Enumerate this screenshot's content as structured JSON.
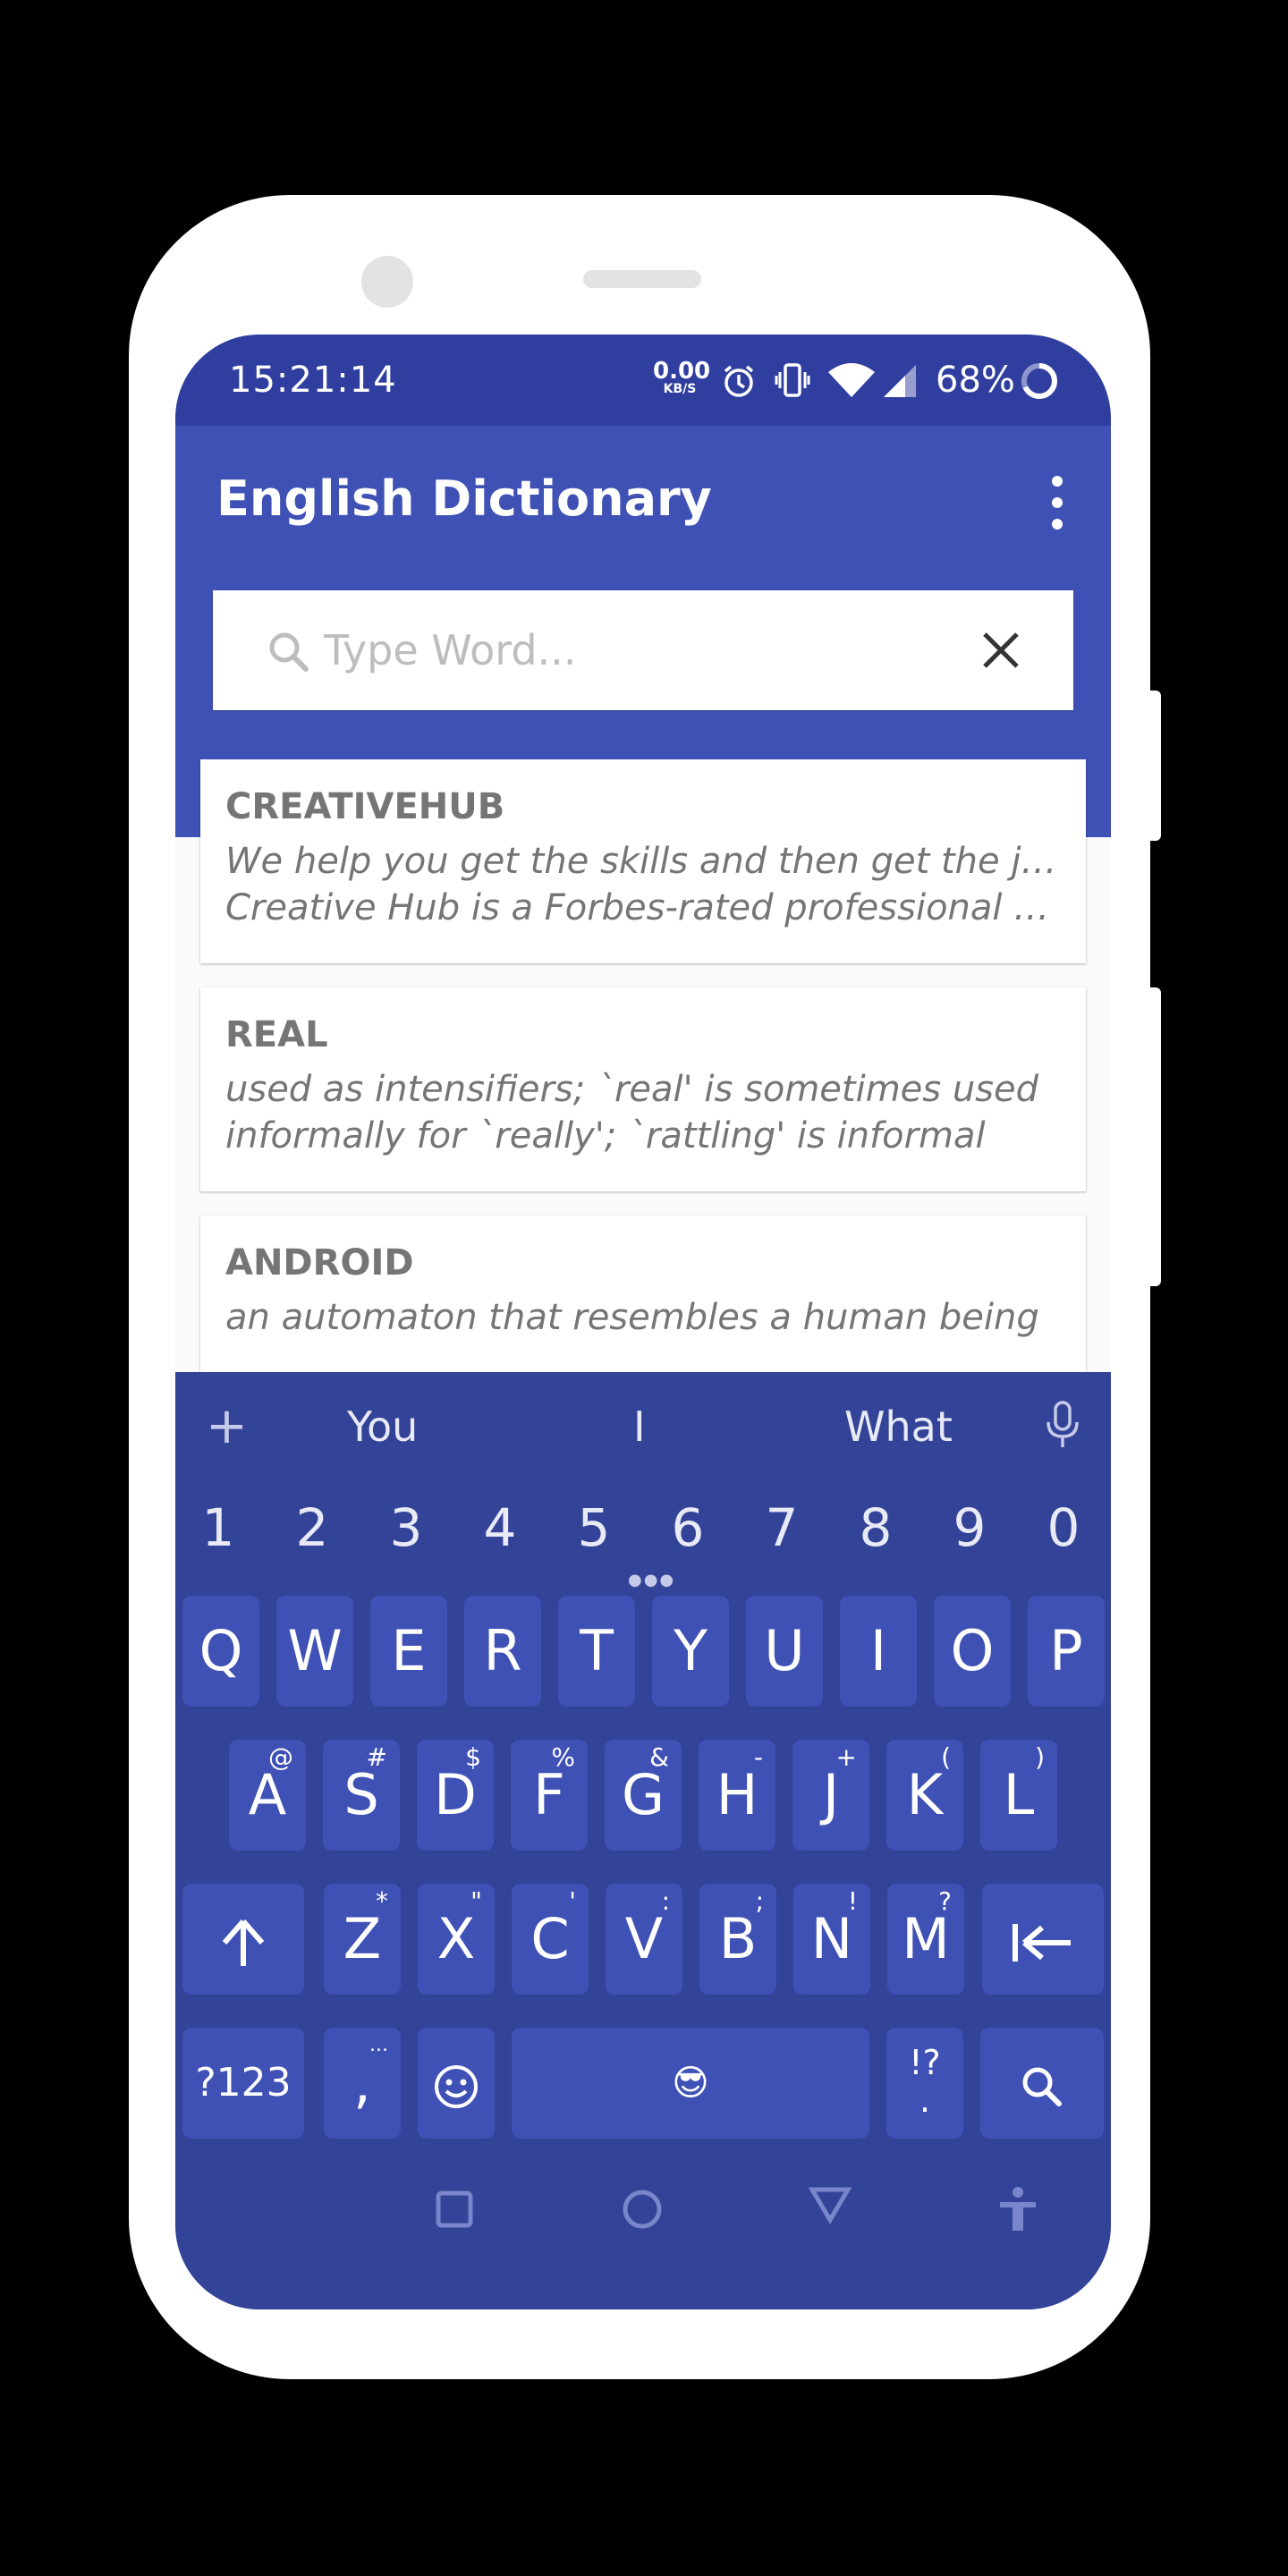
{
  "status": {
    "time": "15:21:14",
    "net_speed": "0.00",
    "net_unit": "KB/S",
    "battery": "68%"
  },
  "app": {
    "title": "English Dictionary"
  },
  "search": {
    "placeholder": "Type Word...",
    "value": ""
  },
  "results": [
    {
      "word": "CREATIVEHUB",
      "line1": "We help you get the skills and then get the job",
      "line2": "Creative Hub is a Forbes-rated professional tr..."
    },
    {
      "word": "REAL",
      "line1": "used as intensifiers; `real' is sometimes used",
      "line2": "informally for `really'; `rattling' is informal"
    },
    {
      "word": "ANDROID",
      "line1": "an automaton that resembles a human being",
      "line2": ""
    }
  ],
  "keyboard": {
    "suggestions": [
      "You",
      "I",
      "What"
    ],
    "numbers": [
      "1",
      "2",
      "3",
      "4",
      "5",
      "6",
      "7",
      "8",
      "9",
      "0"
    ],
    "row1": [
      "Q",
      "W",
      "E",
      "R",
      "T",
      "Y",
      "U",
      "I",
      "O",
      "P"
    ],
    "row2": [
      {
        "key": "A",
        "alt": "@"
      },
      {
        "key": "S",
        "alt": "#"
      },
      {
        "key": "D",
        "alt": "$"
      },
      {
        "key": "F",
        "alt": "%"
      },
      {
        "key": "G",
        "alt": "&"
      },
      {
        "key": "H",
        "alt": "-"
      },
      {
        "key": "J",
        "alt": "+"
      },
      {
        "key": "K",
        "alt": "("
      },
      {
        "key": "L",
        "alt": ")"
      }
    ],
    "row3": [
      {
        "key": "Z",
        "alt": "*"
      },
      {
        "key": "X",
        "alt": "\""
      },
      {
        "key": "C",
        "alt": "'"
      },
      {
        "key": "V",
        "alt": ":"
      },
      {
        "key": "B",
        "alt": ";"
      },
      {
        "key": "N",
        "alt": "!"
      },
      {
        "key": "M",
        "alt": "?"
      }
    ],
    "symbols_label": "?123",
    "comma": ",",
    "comma_alt": "...",
    "period_label": "!?",
    "period_sub": ".",
    "space_emoji": "😎"
  },
  "icons": {
    "menu": "more-vert-icon",
    "search": "search-icon",
    "clear": "close-icon",
    "mic": "mic-icon",
    "shift": "shift-arrow-icon",
    "backspace": "backspace-icon",
    "emoji": "smiley-icon",
    "keyboard_search": "search-icon",
    "nav_recents": "square-icon",
    "nav_home": "circle-icon",
    "nav_back": "triangle-icon",
    "nav_accessibility": "accessibility-icon"
  },
  "colors": {
    "status_bar": "#303f9f",
    "app_bar": "#3f51b5",
    "keyboard_bg": "#334397",
    "key_bg": "#3f51b5"
  }
}
